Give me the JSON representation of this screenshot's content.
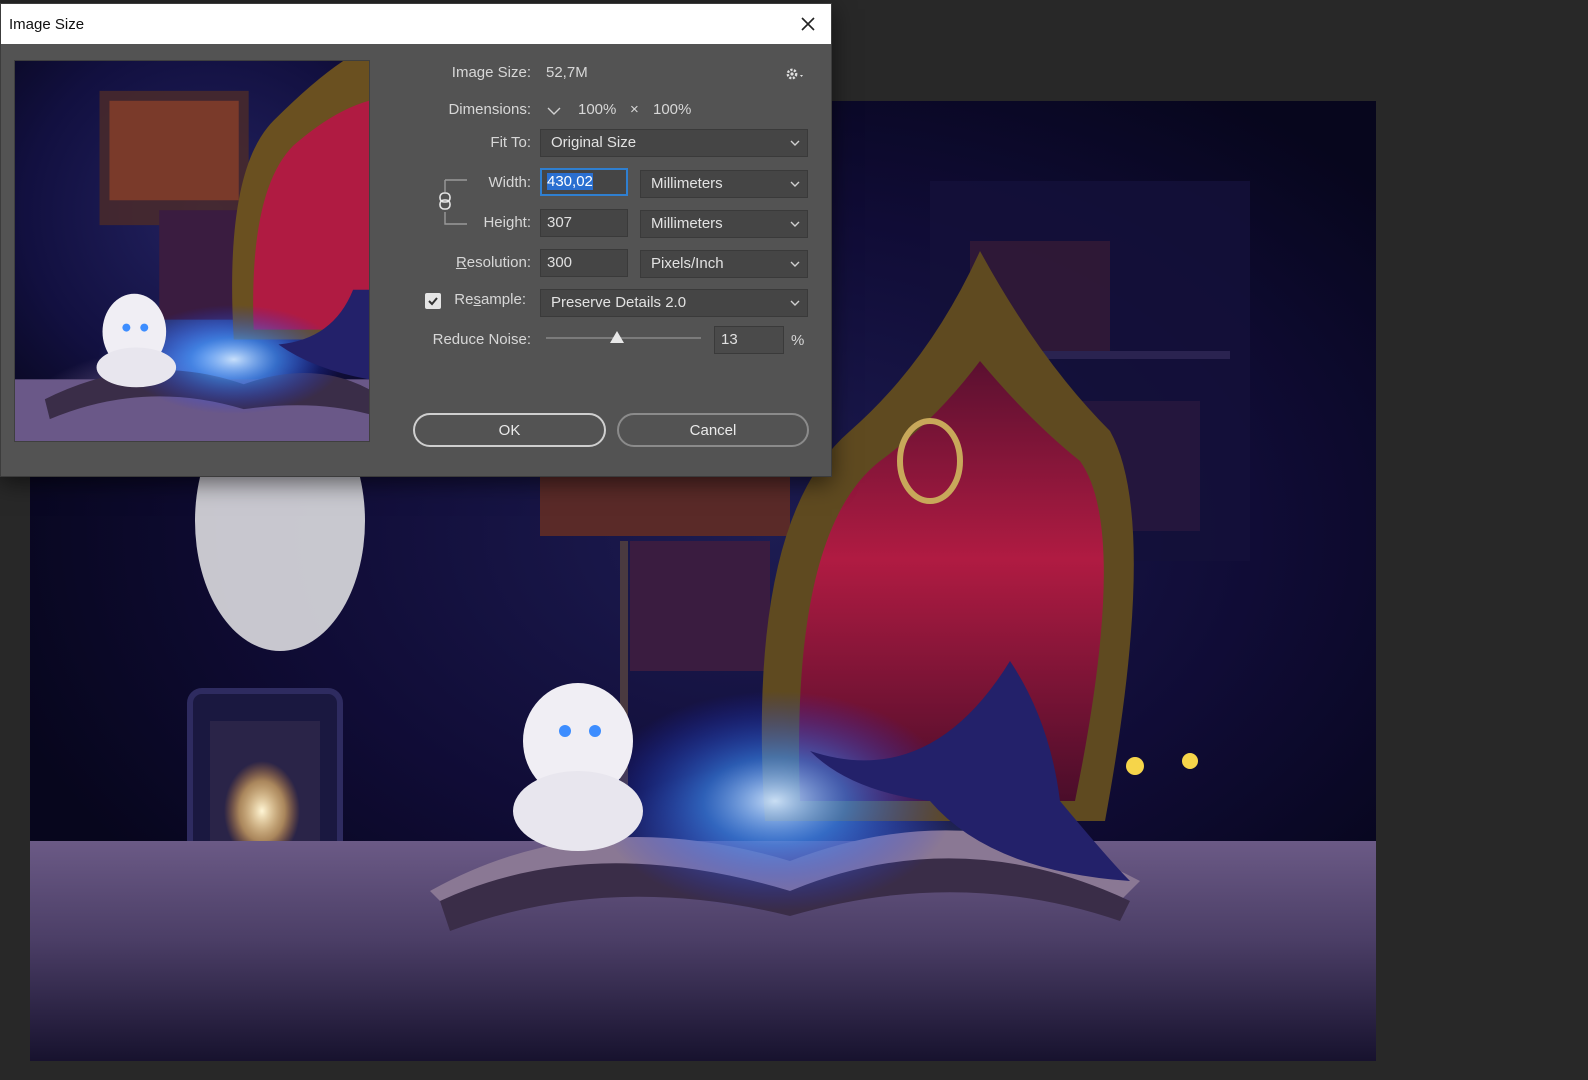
{
  "dialog": {
    "title": "Image Size",
    "image_size_label": "Image Size:",
    "image_size_value": "52,7M",
    "dimensions_label": "Dimensions:",
    "dimensions_width": "100%",
    "dimensions_sep": "×",
    "dimensions_height": "100%",
    "fit_to_label": "Fit To:",
    "fit_to_value": "Original Size",
    "width_label": "Width:",
    "width_value": "430,02",
    "width_unit": "Millimeters",
    "height_label": "Height:",
    "height_value": "307",
    "height_unit": "Millimeters",
    "resolution_label_pre": "",
    "resolution_label_u": "R",
    "resolution_label_post": "esolution:",
    "resolution_value": "300",
    "resolution_unit": "Pixels/Inch",
    "resample_label_pre": "Re",
    "resample_label_u": "s",
    "resample_label_post": "ample:",
    "resample_checked": true,
    "resample_value": "Preserve Details 2.0",
    "reduce_noise_label": "Reduce Noise:",
    "reduce_noise_value": "13",
    "reduce_noise_level": 0.13,
    "percent_sign": "%",
    "ok_label": "OK",
    "cancel_label": "Cancel"
  },
  "icons": {
    "close": "close-icon",
    "settings": "gear-icon",
    "chain": "link-chain-icon",
    "chevron": "chevron-down-icon",
    "check": "checkmark-icon"
  },
  "colors": {
    "dialog_bg": "#535353",
    "field_bg": "#454545",
    "focus_blue": "#2f7fd0",
    "canvas_bg": "#100c36",
    "chair_red": "#a3173a"
  }
}
